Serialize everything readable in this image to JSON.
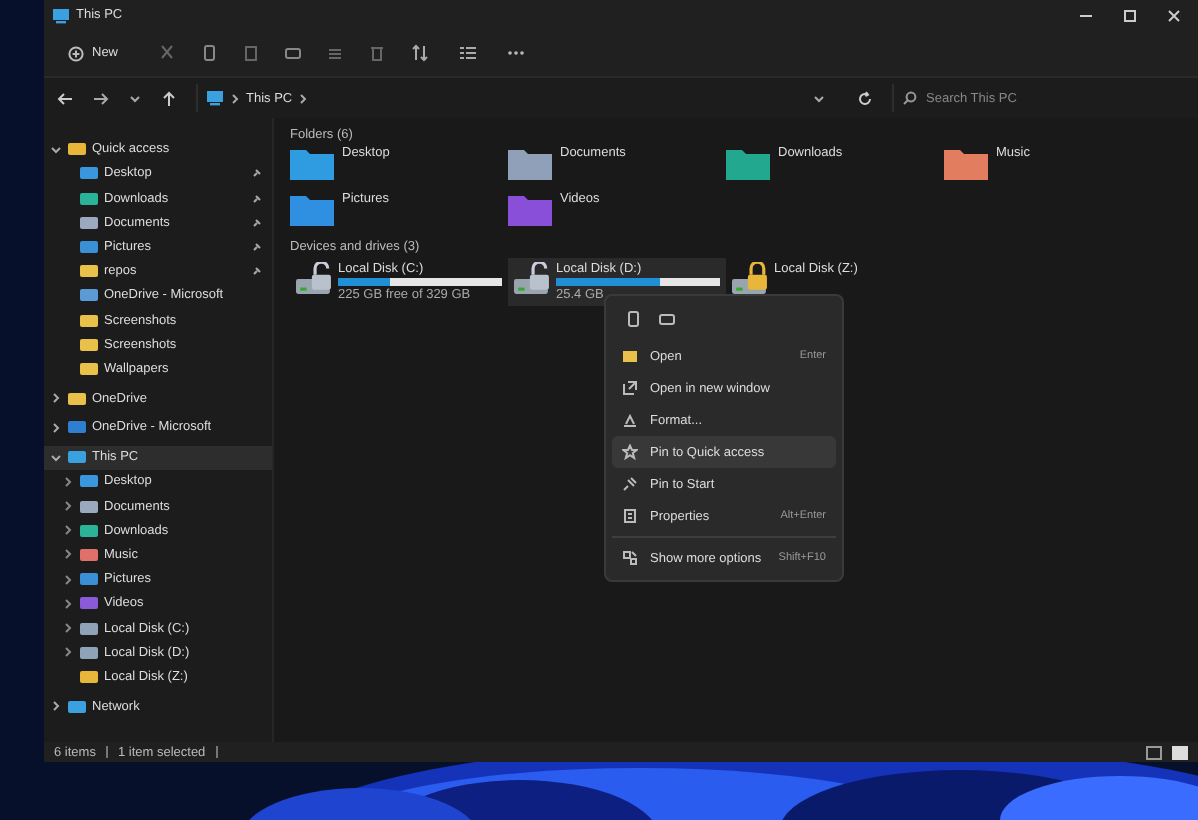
{
  "window": {
    "title": "This PC"
  },
  "toolbar": {
    "new_label": "New"
  },
  "address": {
    "path": "This PC",
    "search_placeholder": "Search This PC"
  },
  "sidebar": {
    "items": [
      {
        "label": "Quick access",
        "color": "#e8b73a",
        "expanded": true,
        "selected": false,
        "children": [
          {
            "label": "Desktop",
            "color": "#3a96dd",
            "pinned": true,
            "selected": false
          },
          {
            "label": "Downloads",
            "color": "#2bb39a",
            "pinned": true,
            "selected": false
          },
          {
            "label": "Documents",
            "color": "#9aa9bd",
            "pinned": true,
            "selected": false
          },
          {
            "label": "Pictures",
            "color": "#3a8fd6",
            "pinned": true,
            "selected": false
          },
          {
            "label": "repos",
            "color": "#e8c04a",
            "pinned": true,
            "selected": false
          },
          {
            "label": "OneDrive - Microsoft",
            "color": "#5b9bd5",
            "pinned": false,
            "selected": false
          },
          {
            "label": "Screenshots",
            "color": "#e8c04a",
            "pinned": false,
            "selected": false
          },
          {
            "label": "Screenshots",
            "color": "#e8c04a",
            "pinned": false,
            "selected": false
          },
          {
            "label": "Wallpapers",
            "color": "#e8c04a",
            "pinned": false,
            "selected": false
          }
        ]
      },
      {
        "label": "OneDrive",
        "color": "#e8c04a",
        "expanded": false,
        "selected": false
      },
      {
        "label": "OneDrive - Microsoft",
        "color": "#2f7fd0",
        "expanded": false,
        "selected": false
      },
      {
        "label": "This PC",
        "color": "#3aa0e0",
        "expanded": true,
        "selected": true,
        "children": [
          {
            "label": "Desktop",
            "color": "#3a96dd",
            "pinned": false,
            "expanded": false,
            "selected": false
          },
          {
            "label": "Documents",
            "color": "#9aa9bd",
            "pinned": false,
            "expanded": false,
            "selected": false
          },
          {
            "label": "Downloads",
            "color": "#2bb39a",
            "pinned": false,
            "expanded": false,
            "selected": false
          },
          {
            "label": "Music",
            "color": "#e0706a",
            "pinned": false,
            "expanded": false,
            "selected": false
          },
          {
            "label": "Pictures",
            "color": "#3a8fd6",
            "pinned": false,
            "expanded": false,
            "selected": false
          },
          {
            "label": "Videos",
            "color": "#8a5ad8",
            "pinned": false,
            "expanded": false,
            "selected": false
          },
          {
            "label": "Local Disk (C:)",
            "color": "#8fa3b8",
            "pinned": false,
            "expanded": false,
            "selected": false
          },
          {
            "label": "Local Disk (D:)",
            "color": "#8fa3b8",
            "pinned": false,
            "expanded": false,
            "selected": false
          },
          {
            "label": "Local Disk (Z:)",
            "color": "#e8b73a",
            "pinned": false,
            "selected": false
          }
        ]
      },
      {
        "label": "Network",
        "color": "#3aa0e0",
        "expanded": false,
        "selected": false
      }
    ]
  },
  "folders": {
    "heading": "Folders (6)",
    "items": [
      {
        "name": "Desktop",
        "color": "#2f9be0"
      },
      {
        "name": "Documents",
        "color": "#8fa0b8"
      },
      {
        "name": "Downloads",
        "color": "#22a88e"
      },
      {
        "name": "Music",
        "color": "#e27d5f"
      },
      {
        "name": "Pictures",
        "color": "#2f8fe0"
      },
      {
        "name": "Videos",
        "color": "#8a4fd8"
      }
    ]
  },
  "drives": {
    "heading": "Devices and drives (3)",
    "items": [
      {
        "name": "Local Disk (C:)",
        "locked": false,
        "level": 0.32,
        "free": "225 GB free of 329 GB",
        "selected": false
      },
      {
        "name": "Local Disk (D:)",
        "locked": false,
        "level": 0.63,
        "free": "25.4 GB",
        "selected": true
      },
      {
        "name": "Local Disk (Z:)",
        "locked": true,
        "selected": false
      }
    ]
  },
  "context_menu": {
    "groups": [
      [
        {
          "kind": "open",
          "label": "Open",
          "shortcut": "Enter",
          "selected": false
        },
        {
          "kind": "new-window",
          "label": "Open in new window",
          "selected": false
        },
        {
          "kind": "format",
          "label": "Format...",
          "selected": false
        },
        {
          "kind": "star",
          "label": "Pin to Quick access",
          "selected": true
        },
        {
          "kind": "pin",
          "label": "Pin to Start",
          "selected": false
        },
        {
          "kind": "properties",
          "label": "Properties",
          "shortcut": "Alt+Enter",
          "selected": false
        }
      ],
      [
        {
          "kind": "more",
          "label": "Show more options",
          "shortcut": "Shift+F10",
          "selected": false
        }
      ]
    ]
  },
  "status_bar": {
    "items_count": "6 items",
    "selection": "1 item selected"
  }
}
